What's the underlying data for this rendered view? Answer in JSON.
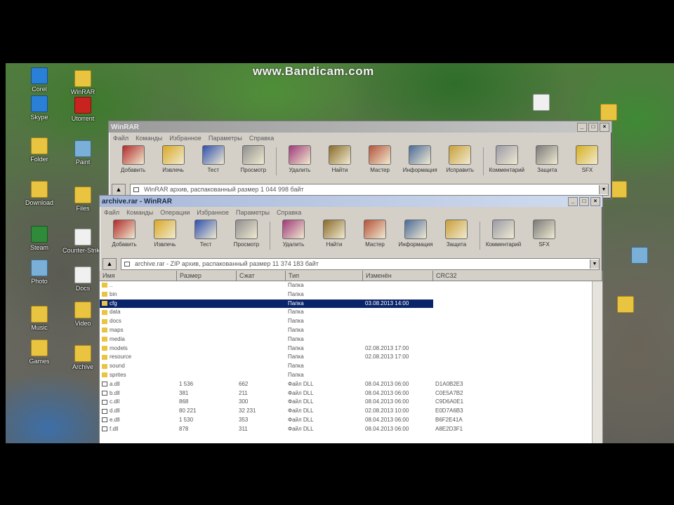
{
  "watermark": "www.Bandicam.com",
  "desktop_icons": [
    {
      "label": "Corel",
      "glyph": "g-blue"
    },
    {
      "label": "WinRAR",
      "glyph": "g-folder"
    },
    {
      "label": "Skype",
      "glyph": "g-blue"
    },
    {
      "label": "Utorrent",
      "glyph": "g-red"
    },
    {
      "label": "Folder",
      "glyph": "g-folder"
    },
    {
      "label": "Paint",
      "glyph": "g-img"
    },
    {
      "label": "Download",
      "glyph": "g-folder"
    },
    {
      "label": "Files",
      "glyph": "g-folder"
    },
    {
      "label": "Steam",
      "glyph": "g-green"
    },
    {
      "label": "Counter-Strike",
      "glyph": "g-file"
    },
    {
      "label": "Photo",
      "glyph": "g-img"
    },
    {
      "label": "Docs",
      "glyph": "g-file"
    },
    {
      "label": "Music",
      "glyph": "g-folder"
    },
    {
      "label": "Video",
      "glyph": "g-folder"
    },
    {
      "label": "Games",
      "glyph": "g-folder"
    },
    {
      "label": "Archive",
      "glyph": "g-folder"
    }
  ],
  "back_window": {
    "title": "WinRAR",
    "menu": [
      "Файл",
      "Команды",
      "Избранное",
      "Параметры",
      "Справка"
    ],
    "toolbar": [
      "Добавить",
      "Извлечь",
      "Тест",
      "Просмотр",
      "Удалить",
      "Найти",
      "Мастер",
      "Информация",
      "Исправить",
      "Комментарий",
      "Защита",
      "SFX"
    ],
    "address": "WinRAR архив, распакованный размер 1 044 998 байт"
  },
  "front_window": {
    "title": "archive.rar - WinRAR",
    "menu": [
      "Файл",
      "Команды",
      "Операции",
      "Избранное",
      "Параметры",
      "Справка"
    ],
    "toolbar": [
      "Добавить",
      "Извлечь",
      "Тест",
      "Просмотр",
      "Удалить",
      "Найти",
      "Мастер",
      "Информация",
      "Защита",
      "Комментарий",
      "SFX"
    ],
    "address": "archive.rar - ZIP архив, распакованный размер 11 374 183 байт",
    "columns": [
      "Имя",
      "Размер",
      "Сжат",
      "Тип",
      "Изменён",
      "CRC32"
    ],
    "rows": [
      {
        "name": "..",
        "size": "",
        "packed": "",
        "type": "Папка",
        "modified": "",
        "crc": "",
        "kind": "folder",
        "selected": false
      },
      {
        "name": "bin",
        "size": "",
        "packed": "",
        "type": "Папка",
        "modified": "",
        "crc": "",
        "kind": "folder",
        "selected": false
      },
      {
        "name": "cfg",
        "size": "",
        "packed": "",
        "type": "Папка",
        "modified": "03.08.2013 14:00",
        "crc": "",
        "kind": "folder",
        "selected": true
      },
      {
        "name": "data",
        "size": "",
        "packed": "",
        "type": "Папка",
        "modified": "",
        "crc": "",
        "kind": "folder",
        "selected": false
      },
      {
        "name": "docs",
        "size": "",
        "packed": "",
        "type": "Папка",
        "modified": "",
        "crc": "",
        "kind": "folder",
        "selected": false
      },
      {
        "name": "maps",
        "size": "",
        "packed": "",
        "type": "Папка",
        "modified": "",
        "crc": "",
        "kind": "folder",
        "selected": false
      },
      {
        "name": "media",
        "size": "",
        "packed": "",
        "type": "Папка",
        "modified": "",
        "crc": "",
        "kind": "folder",
        "selected": false
      },
      {
        "name": "models",
        "size": "",
        "packed": "",
        "type": "Папка",
        "modified": "02.08.2013 17:00",
        "crc": "",
        "kind": "folder",
        "selected": false
      },
      {
        "name": "resource",
        "size": "",
        "packed": "",
        "type": "Папка",
        "modified": "02.08.2013 17:00",
        "crc": "",
        "kind": "folder",
        "selected": false
      },
      {
        "name": "sound",
        "size": "",
        "packed": "",
        "type": "Папка",
        "modified": "",
        "crc": "",
        "kind": "folder",
        "selected": false
      },
      {
        "name": "sprites",
        "size": "",
        "packed": "",
        "type": "Папка",
        "modified": "",
        "crc": "",
        "kind": "folder",
        "selected": false
      },
      {
        "name": "a.dll",
        "size": "1 536",
        "packed": "662",
        "type": "Файл DLL",
        "modified": "08.04.2013 06:00",
        "crc": "D1A0B2E3",
        "kind": "file",
        "selected": false
      },
      {
        "name": "b.dll",
        "size": "381",
        "packed": "211",
        "type": "Файл DLL",
        "modified": "08.04.2013 06:00",
        "crc": "C0E5A7B2",
        "kind": "file",
        "selected": false
      },
      {
        "name": "c.dll",
        "size": "868",
        "packed": "300",
        "type": "Файл DLL",
        "modified": "08.04.2013 06:00",
        "crc": "C9D6A0E1",
        "kind": "file",
        "selected": false
      },
      {
        "name": "d.dll",
        "size": "80 221",
        "packed": "32 231",
        "type": "Файл DLL",
        "modified": "02.08.2013 10:00",
        "crc": "E0D7A6B3",
        "kind": "file",
        "selected": false
      },
      {
        "name": "e.dll",
        "size": "1 530",
        "packed": "353",
        "type": "Файл DLL",
        "modified": "08.04.2013 06:00",
        "crc": "B6F2E41A",
        "kind": "file",
        "selected": false
      },
      {
        "name": "f.dll",
        "size": "878",
        "packed": "311",
        "type": "Файл DLL",
        "modified": "08.04.2013 06:00",
        "crc": "A8E2D3F1",
        "kind": "file",
        "selected": false
      }
    ]
  }
}
